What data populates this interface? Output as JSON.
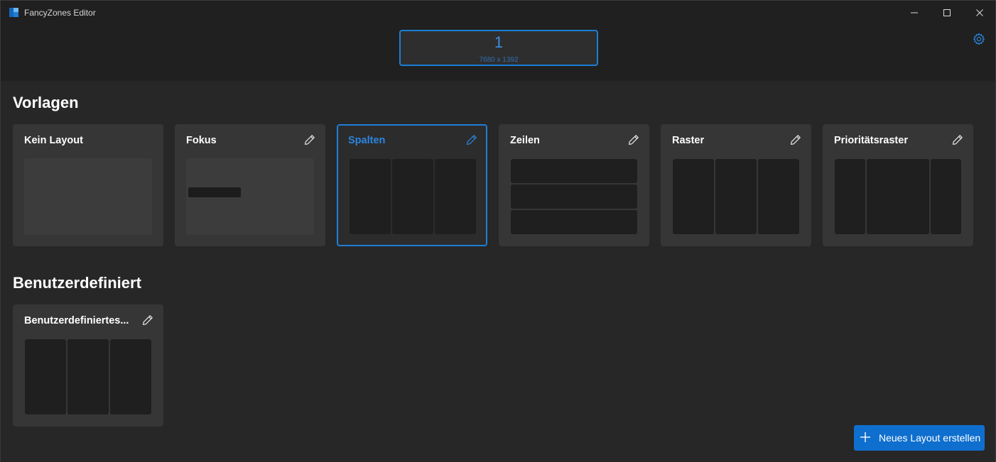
{
  "window": {
    "title": "FancyZones Editor",
    "buttons": [
      "minimize-icon",
      "maximize-icon",
      "close-icon"
    ]
  },
  "monitor": {
    "number": "1",
    "resolution": "7680 x 1392"
  },
  "sections": {
    "templates_title": "Vorlagen",
    "custom_title": "Benutzerdefiniert"
  },
  "templates": [
    {
      "name": "Kein Layout",
      "editable": false,
      "selected": false,
      "preview": "none"
    },
    {
      "name": "Fokus",
      "editable": true,
      "selected": false,
      "preview": "focus"
    },
    {
      "name": "Spalten",
      "editable": true,
      "selected": true,
      "preview": "columns"
    },
    {
      "name": "Zeilen",
      "editable": true,
      "selected": false,
      "preview": "rows"
    },
    {
      "name": "Raster",
      "editable": true,
      "selected": false,
      "preview": "grid"
    },
    {
      "name": "Prioritätsraster",
      "editable": true,
      "selected": false,
      "preview": "priority-grid"
    }
  ],
  "custom_layouts": [
    {
      "name": "Benutzerdefiniertes...",
      "editable": true,
      "selected": false,
      "preview": "columns"
    }
  ],
  "actions": {
    "new_layout_label": "Neues Layout erstellen"
  },
  "colors": {
    "accent": "#1f7fd6",
    "button": "#0f6fcf",
    "background": "#272727",
    "card": "#363636"
  }
}
